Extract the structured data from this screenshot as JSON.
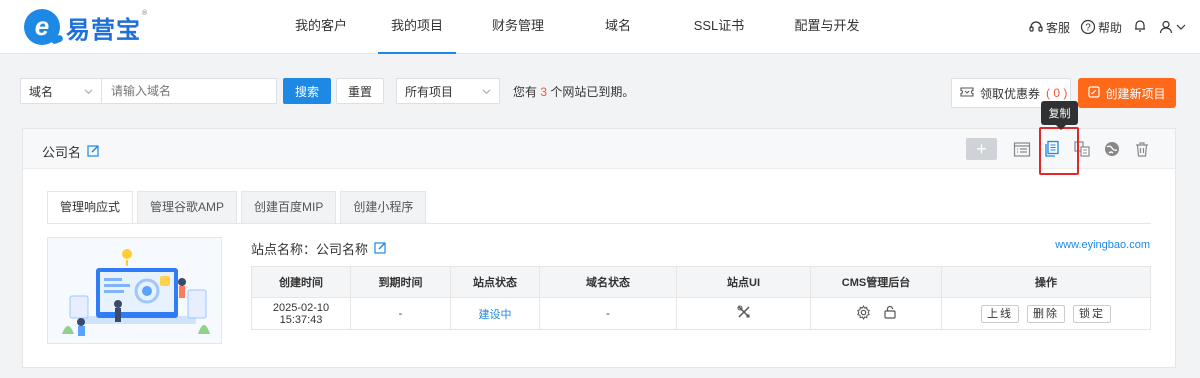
{
  "brand": {
    "name": "易营宝",
    "mark": "e",
    "reg": "®",
    "color": "#1e88e5"
  },
  "nav": {
    "items": [
      {
        "label": "我的客户"
      },
      {
        "label": "我的项目",
        "active": true
      },
      {
        "label": "财务管理"
      },
      {
        "label": "域名"
      },
      {
        "label": "SSL证书"
      },
      {
        "label": "配置与开发"
      }
    ]
  },
  "top_right": {
    "service": "客服",
    "help": "帮助",
    "icons": [
      "headset-icon",
      "help-circle-icon",
      "bell-icon",
      "user-icon",
      "chevron-down-icon"
    ]
  },
  "filter": {
    "field_select": "域名",
    "search_placeholder": "请输入域名",
    "search_label": "搜索",
    "reset_label": "重置",
    "project_select": "所有项目",
    "expire_prefix": "您有 ",
    "expire_count": "3",
    "expire_suffix": " 个网站已到期。"
  },
  "actions": {
    "coupon_label": "领取优惠券",
    "coupon_count": "( 0 )",
    "create_label": "创建新项目",
    "create_color": "#ff6a1a"
  },
  "tooltip": {
    "text": "复制"
  },
  "project": {
    "company_name": "公司名",
    "tools": [
      "add-icon",
      "folder-list-icon",
      "copy-icon",
      "transfer-icon",
      "globe-icon",
      "trash-icon"
    ],
    "tabs": [
      {
        "label": "管理响应式",
        "active": true
      },
      {
        "label": "管理谷歌AMP"
      },
      {
        "label": "创建百度MIP"
      },
      {
        "label": "创建小程序"
      }
    ],
    "site_title": "站点名称：公司名称",
    "site_url": "www.eyingbao.com",
    "table": {
      "headers": [
        "创建时间",
        "到期时间",
        "站点状态",
        "域名状态",
        "站点UI",
        "CMS管理后台",
        "操作"
      ],
      "row": {
        "created": "2025-02-10 15:37:43",
        "expires": "-",
        "status": "建设中",
        "domain_status": "-",
        "ops": [
          "上线",
          "删除",
          "锁定"
        ]
      }
    }
  }
}
